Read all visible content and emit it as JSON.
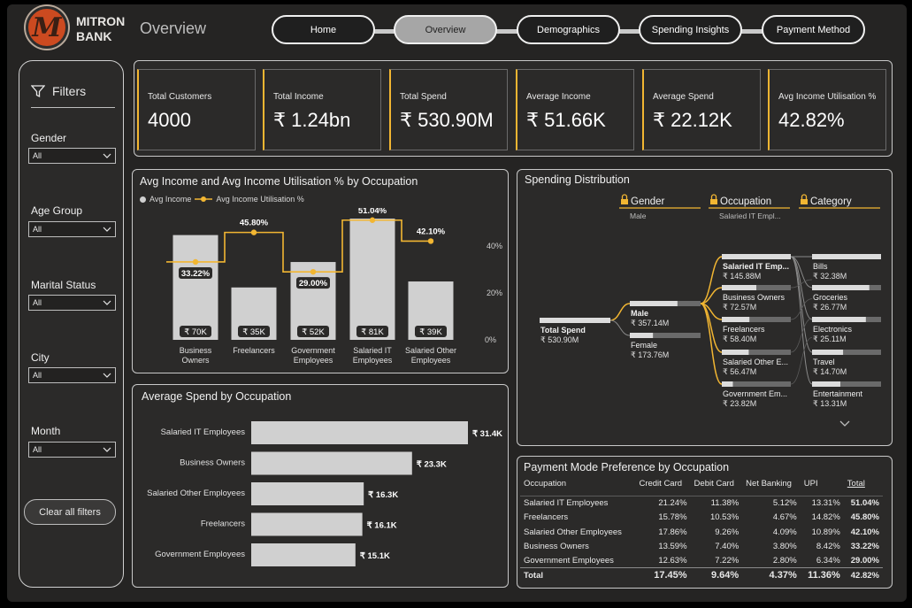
{
  "header": {
    "brand_line1": "MITRON",
    "brand_line2": "BANK",
    "logo_letter": "M",
    "page_title": "Overview"
  },
  "nav": [
    {
      "label": "Home"
    },
    {
      "label": "Overview"
    },
    {
      "label": "Demographics"
    },
    {
      "label": "Spending Insights"
    },
    {
      "label": "Payment Method"
    }
  ],
  "sidebar": {
    "title": "Filters",
    "filters": [
      {
        "label": "Gender",
        "value": "All"
      },
      {
        "label": "Age Group",
        "value": "All"
      },
      {
        "label": "Marital Status",
        "value": "All"
      },
      {
        "label": "City",
        "value": "All"
      },
      {
        "label": "Month",
        "value": "All"
      }
    ],
    "clear_label": "Clear all filters"
  },
  "kpis": [
    {
      "label": "Total Customers",
      "value": "4000"
    },
    {
      "label": "Total Income",
      "value": "₹ 1.24bn"
    },
    {
      "label": "Total Spend",
      "value": "₹ 530.90M"
    },
    {
      "label": "Average Income",
      "value": "₹ 51.66K"
    },
    {
      "label": "Average Spend",
      "value": "₹ 22.12K"
    },
    {
      "label": "Avg Income Utilisation %",
      "value": "42.82%"
    }
  ],
  "combo_chart": {
    "title": "Avg Income and Avg Income Utilisation % by Occupation",
    "legend_bar": "Avg Income",
    "legend_line": "Avg Income Utilisation %",
    "y2_ticks": [
      "40%",
      "20%",
      "0%"
    ]
  },
  "spend_chart": {
    "title": "Average Spend by Occupation"
  },
  "decomp": {
    "title": "Spending Distribution",
    "levels": [
      {
        "label": "Gender",
        "selected": "Male"
      },
      {
        "label": "Occupation",
        "selected": "Salaried IT Empl..."
      },
      {
        "label": "Category",
        "selected": ""
      }
    ],
    "root": {
      "label": "Total Spend",
      "value": "₹ 530.90M"
    },
    "gender": [
      {
        "label": "Male",
        "value": "₹ 357.14M",
        "share": 0.673
      },
      {
        "label": "Female",
        "value": "₹ 173.76M",
        "share": 0.327
      }
    ],
    "occupation": [
      {
        "label": "Salaried IT Emp...",
        "value": "₹ 145.88M",
        "share": 1.0
      },
      {
        "label": "Business Owners",
        "value": "₹ 72.57M",
        "share": 0.5
      },
      {
        "label": "Freelancers",
        "value": "₹ 58.40M",
        "share": 0.4
      },
      {
        "label": "Salaried Other E...",
        "value": "₹ 56.47M",
        "share": 0.39
      },
      {
        "label": "Government Em...",
        "value": "₹ 23.82M",
        "share": 0.16
      }
    ],
    "category": [
      {
        "label": "Bills",
        "value": "₹ 32.38M",
        "share": 1.0
      },
      {
        "label": "Groceries",
        "value": "₹ 26.77M",
        "share": 0.83
      },
      {
        "label": "Electronics",
        "value": "₹ 25.11M",
        "share": 0.78
      },
      {
        "label": "Travel",
        "value": "₹ 14.70M",
        "share": 0.45
      },
      {
        "label": "Entertainment",
        "value": "₹ 13.31M",
        "share": 0.41
      }
    ]
  },
  "payment_table": {
    "title": "Payment Mode Preference by Occupation",
    "columns": [
      "Occupation",
      "Credit Card",
      "Debit Card",
      "Net Banking",
      "UPI",
      "Total"
    ],
    "rows": [
      [
        "Salaried IT Employees",
        "21.24%",
        "11.38%",
        "5.12%",
        "13.31%",
        "51.04%"
      ],
      [
        "Freelancers",
        "15.78%",
        "10.53%",
        "4.67%",
        "14.82%",
        "45.80%"
      ],
      [
        "Salaried Other Employees",
        "17.86%",
        "9.26%",
        "4.09%",
        "10.89%",
        "42.10%"
      ],
      [
        "Business Owners",
        "13.59%",
        "7.40%",
        "3.80%",
        "8.42%",
        "33.22%"
      ],
      [
        "Government Employees",
        "12.63%",
        "7.22%",
        "2.80%",
        "6.34%",
        "29.00%"
      ]
    ],
    "total_row": [
      "Total",
      "17.45%",
      "9.64%",
      "4.37%",
      "11.36%",
      "42.82%"
    ]
  },
  "colors": {
    "accent": "#f2b632",
    "bar": "#d0d0d0",
    "background": "#252423"
  },
  "chart_data": [
    {
      "type": "bar",
      "title": "Avg Income and Avg Income Utilisation % by Occupation",
      "categories": [
        "Business Owners",
        "Freelancers",
        "Government Employees",
        "Salaried IT Employees",
        "Salaried Other Employees"
      ],
      "series": [
        {
          "name": "Avg Income",
          "values": [
            70,
            35,
            52,
            81,
            39
          ],
          "labels": [
            "₹ 70K",
            "₹ 35K",
            "₹ 52K",
            "₹ 81K",
            "₹ 39K"
          ]
        },
        {
          "name": "Avg Income Utilisation %",
          "values": [
            33.22,
            45.8,
            29.0,
            51.04,
            42.1
          ],
          "labels": [
            "33.22%",
            "45.80%",
            "29.00%",
            "51.04%",
            "42.10%"
          ]
        }
      ],
      "y2lim": [
        0,
        55
      ]
    },
    {
      "type": "bar",
      "title": "Average Spend by Occupation",
      "categories": [
        "Salaried IT Employees",
        "Business Owners",
        "Salaried Other Employees",
        "Freelancers",
        "Government Employees"
      ],
      "values": [
        31.4,
        23.3,
        16.3,
        16.1,
        15.1
      ],
      "labels": [
        "₹ 31.4K",
        "₹ 23.3K",
        "₹ 16.3K",
        "₹ 16.1K",
        "₹ 15.1K"
      ]
    }
  ]
}
